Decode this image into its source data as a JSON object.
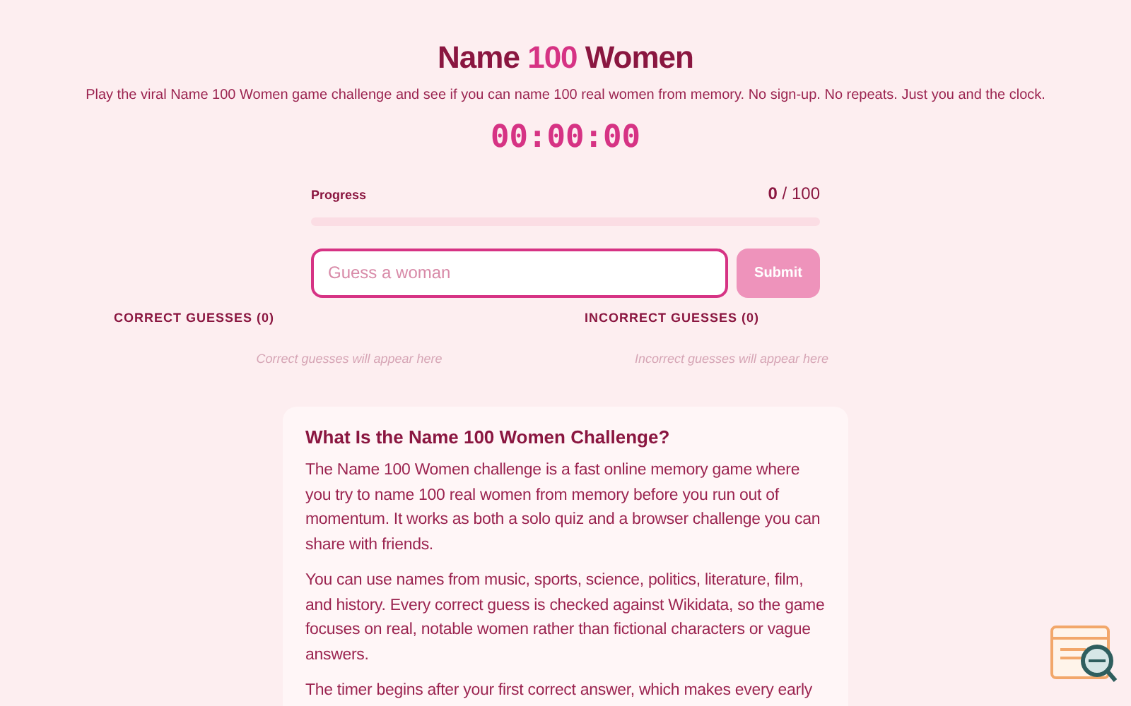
{
  "header": {
    "title_before": "Name",
    "title_highlight": "100",
    "title_after": "Women",
    "subtitle": "Play the viral Name 100 Women game challenge and see if you can name 100 real women from memory. No sign-up. No repeats. Just you and the clock."
  },
  "timer": "00:00:00",
  "progress": {
    "label": "Progress",
    "count": "0",
    "total": "/ 100",
    "level": 0
  },
  "guess": {
    "placeholder": "Guess a woman",
    "button": "Submit",
    "button_disabled": true
  },
  "lists": [
    {
      "heading": "CORRECT GUESSES (0)",
      "empty": "Correct guesses will appear here"
    },
    {
      "heading": "INCORRECT GUESSES (0)",
      "empty": "Incorrect guesses will appear here"
    }
  ],
  "info": {
    "heading": "What Is the Name 100 Women Challenge?",
    "paragraphs": [
      "The Name 100 Women challenge is a fast online memory game where you try to name 100 real women from memory before you run out of momentum. It works as both a solo quiz and a browser challenge you can share with friends.",
      "You can use names from music, sports, science, politics, literature, film, and history. Every correct guess is checked against Wikidata, so the game focuses on real, notable women rather than fictional characters or vague answers.",
      "The timer begins after your first correct answer, which makes every early"
    ]
  }
}
